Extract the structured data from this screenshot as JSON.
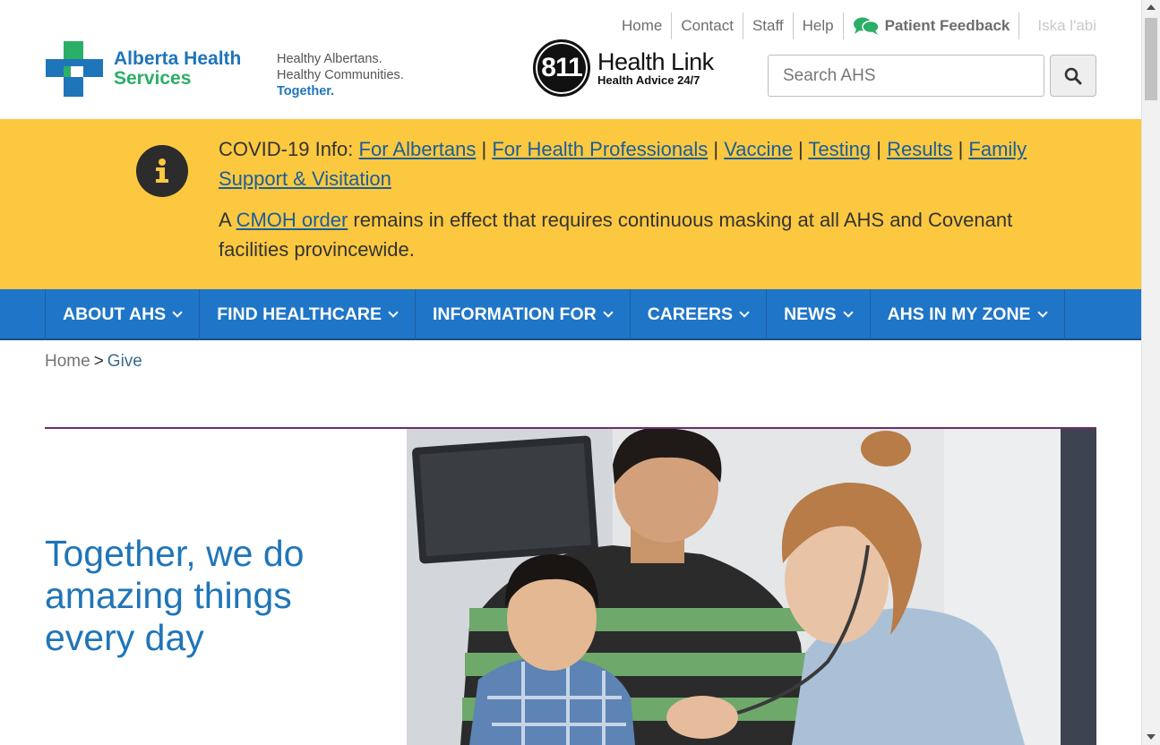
{
  "utility_nav": {
    "items": [
      "Home",
      "Contact",
      "Staff",
      "Help"
    ],
    "feedback": "Patient Feedback",
    "language": "Iska l'abi"
  },
  "logo": {
    "line1": "Alberta Health",
    "line2": "Services"
  },
  "tagline": {
    "line1": "Healthy Albertans.",
    "line2": "Healthy Communities.",
    "line3": "Together."
  },
  "healthlink": {
    "number": "811",
    "title": "Health Link",
    "subtitle": "Health Advice 24/7"
  },
  "search": {
    "placeholder": "Search AHS"
  },
  "alert": {
    "prefix": "COVID-19 Info:",
    "links": [
      "For Albertans",
      "For Health Professionals",
      "Vaccine",
      "Testing",
      "Results",
      "Family Support & Visitation"
    ],
    "separator": "|",
    "notice_start": "A",
    "notice_link": "CMOH order",
    "notice_end": "remains in effect that requires continuous masking at all AHS and Covenant facilities provincewide."
  },
  "main_nav": {
    "items": [
      "ABOUT AHS",
      "FIND HEALTHCARE",
      "INFORMATION FOR",
      "CAREERS",
      "NEWS",
      "AHS IN MY ZONE"
    ]
  },
  "breadcrumb": {
    "home": "Home",
    "separator": ">",
    "current": "Give"
  },
  "hero": {
    "title": "Together, we do amazing things every day"
  },
  "colors": {
    "brand_blue": "#1f75b9",
    "brand_green": "#2bae66",
    "alert_yellow": "#fcc840",
    "nav_blue": "#1f75c8",
    "rule_purple": "#6a2f6a"
  }
}
